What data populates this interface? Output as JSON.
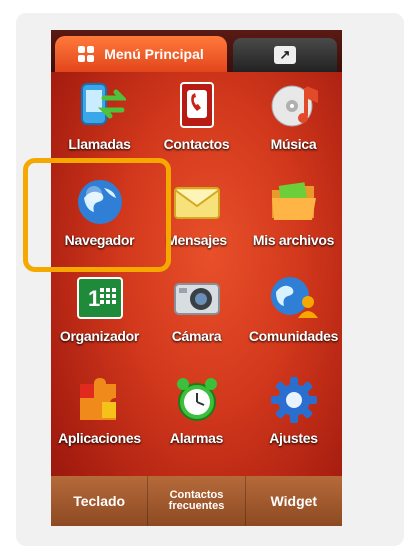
{
  "tabs": {
    "main_label": "Menú Principal",
    "second_icon": "arrow-icon"
  },
  "apps": [
    {
      "label": "Llamadas",
      "icon": "phone-call-icon"
    },
    {
      "label": "Contactos",
      "icon": "contacts-book-icon"
    },
    {
      "label": "Música",
      "icon": "music-disc-icon"
    },
    {
      "label": "Navegador",
      "icon": "globe-icon"
    },
    {
      "label": "Mensajes",
      "icon": "envelope-icon"
    },
    {
      "label": "Mis archivos",
      "icon": "folder-icon"
    },
    {
      "label": "Organizador",
      "icon": "calendar-icon"
    },
    {
      "label": "Cámara",
      "icon": "camera-icon"
    },
    {
      "label": "Comunidades",
      "icon": "community-globe-icon"
    },
    {
      "label": "Aplicaciones",
      "icon": "puzzle-icon"
    },
    {
      "label": "Alarmas",
      "icon": "alarm-clock-icon"
    },
    {
      "label": "Ajustes",
      "icon": "settings-gear-icon"
    }
  ],
  "bottombar": {
    "teclado": "Teclado",
    "contactos_line1": "Contactos",
    "contactos_line2": "frecuentes",
    "widget": "Widget"
  },
  "colors": {
    "highlight": "#f5a800",
    "screen_bg": "#d2381c"
  }
}
